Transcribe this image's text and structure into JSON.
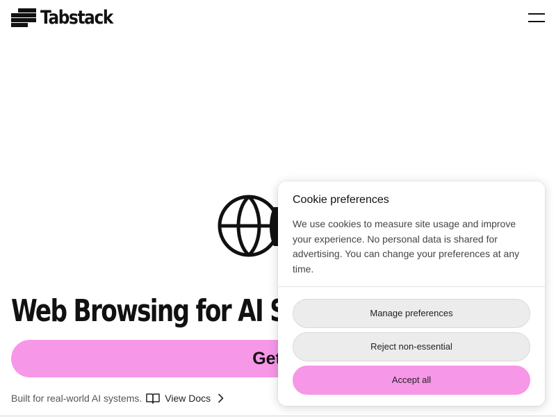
{
  "brand": {
    "name": "Tabstack",
    "accent_color": "#f797e8"
  },
  "header": {
    "menu_icon": "hamburger-menu-icon"
  },
  "hero": {
    "icon": "globe-icon",
    "title": "Web Browsing for AI Syst",
    "cta_label": "Get St",
    "tagline": "Built for real-world AI systems.",
    "docs_label": "View Docs",
    "docs_icon": "book-icon",
    "docs_chevron": "chevron-right-icon"
  },
  "cookie_panel": {
    "title": "Cookie preferences",
    "body": "We use cookies to measure site usage and improve your experience. No personal data is shared for advertising. You can change your preferences at any time.",
    "buttons": {
      "manage": "Manage preferences",
      "reject": "Reject non-essential",
      "accept": "Accept all"
    }
  }
}
